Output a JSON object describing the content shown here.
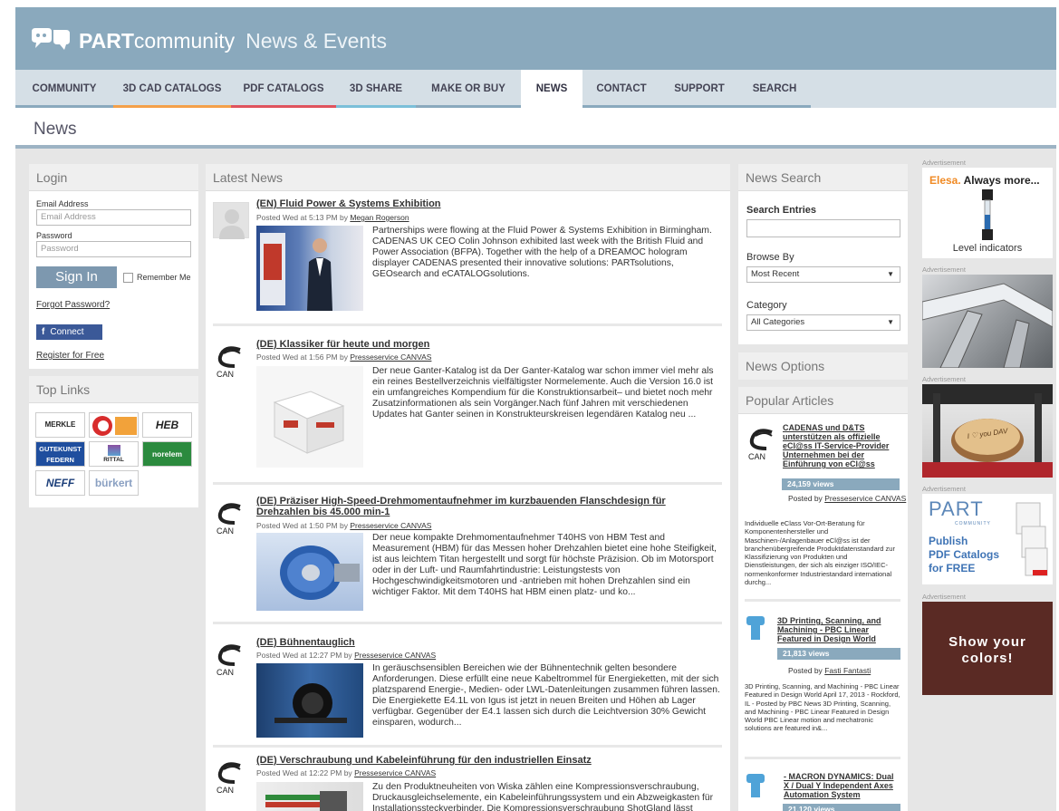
{
  "header": {
    "brand_bold": "PART",
    "brand_light": "community",
    "subtitle": "News & Events"
  },
  "nav": {
    "items": [
      {
        "label": "COMMUNITY",
        "color": "#8aa9bd"
      },
      {
        "label": "3D CAD CATALOGS",
        "color": "#f4a04a"
      },
      {
        "label": "PDF CATALOGS",
        "color": "#e0535d"
      },
      {
        "label": "3D SHARE",
        "color": "#7bbfd9"
      },
      {
        "label": "MAKE OR BUY",
        "color": "#8aa9bd"
      },
      {
        "label": "NEWS",
        "color": "#8aa9bd"
      },
      {
        "label": "CONTACT",
        "color": "#8aa9bd"
      },
      {
        "label": "SUPPORT",
        "color": "#8aa9bd"
      },
      {
        "label": "SEARCH",
        "color": "#8aa9bd"
      }
    ],
    "active": "NEWS"
  },
  "page": {
    "title": "News"
  },
  "login": {
    "heading": "Login",
    "email_label": "Email Address",
    "email_placeholder": "Email Address",
    "password_label": "Password",
    "password_placeholder": "Password",
    "signin": "Sign In",
    "remember": "Remember Me",
    "forgot": "Forgot Password?",
    "connect": "Connect",
    "register": "Register for Free"
  },
  "top_links": {
    "heading": "Top Links",
    "logos": [
      "MERKLE",
      "GANTER",
      "HEB",
      "GUTEKUNST FEDERN",
      "RITTAL",
      "norelem",
      "NEFF",
      "bürkert"
    ]
  },
  "news": {
    "heading": "Latest News",
    "articles": [
      {
        "title": "(EN) Fluid Power & Systems Exhibition",
        "meta": "Posted Wed at 5:13 PM by",
        "author": "Megan Rogerson",
        "text": "Partnerships were flowing at the Fluid Power & Systems Exhibition in Birmingham. CADENAS UK CEO Colin Johnson exhibited last week with the British Fluid and Power Association (BFPA). Together with the help of a DREAMOC hologram displayer CADENAS presented their innovative solutions: PARTsolutions, GEOsearch and eCATALOGsolutions."
      },
      {
        "title": "(DE) Klassiker für heute und morgen",
        "meta": "Posted Wed at 1:56 PM by",
        "author": "Presseservice CANVAS",
        "text": "Der neue Ganter-Katalog ist da Der Ganter-Katalog war schon immer viel mehr als ein reines Bestellverzeichnis vielfältigster Normelemente. Auch die Version 16.0 ist ein umfangreiches Kompendium für die Konstruktionsarbeit– und bietet noch mehr Zusatzinformationen als sein Vorgänger.Nach fünf Jahren mit verschiedenen Updates hat Ganter seinen in Konstrukteurskreisen legendären Katalog neu ..."
      },
      {
        "title": "(DE) Präziser High-Speed-Drehmomentaufnehmer im kurzbauenden Flanschdesign für Drehzahlen bis 45.000 min-1",
        "meta": "Posted Wed at 1:50 PM by",
        "author": "Presseservice CANVAS",
        "text": "Der neue kompakte Drehmomentaufnehmer T40HS von HBM Test and Measurement (HBM) für das Messen hoher Drehzahlen bietet eine hohe Steifigkeit, ist aus leichtem Titan hergestellt und sorgt für höchste Präzision.  Ob im Motorsport oder in der Luft- und Raumfahrtindustrie: Leistungstests von Hochgeschwindigkeitsmotoren und -antrieben mit hohen Drehzahlen sind ein wichtiger Faktor. Mit dem T40HS hat HBM einen platz- und ko..."
      },
      {
        "title": "(DE) Bühnentauglich",
        "meta": "Posted Wed at 12:27 PM by",
        "author": "Presseservice CANVAS",
        "text": "In geräuschsensiblen Bereichen wie der Bühnentechnik gelten besondere Anforderungen. Diese erfüllt eine neue Kabeltrommel für Energieketten, mit der sich platzsparend Energie-, Medien- oder LWL-Datenleitungen zusammen führen lassen. Die Energiekette E4.1L von Igus ist jetzt in neuen Breiten und Höhen ab Lager verfügbar. Gegenüber der E4.1 lassen sich durch die Leichtversion 30% Gewicht einsparen, wodurch..."
      },
      {
        "title": "(DE) Verschraubung und Kabeleinführung für den industriellen Einsatz",
        "meta": "Posted Wed at 12:22 PM by",
        "author": "Presseservice CANVAS",
        "text": "Zu den Produktneuheiten von Wiska zählen eine Kompressionsverschraubung, Druckausgleichselemente, ein Kabeleinführungssystem und ein Abzweigkasten für Installationssteckverbinder. Die Kompressionsverschraubung ShotGland lässt"
      }
    ]
  },
  "search": {
    "heading": "News Search",
    "entries_label": "Search Entries",
    "browse_label": "Browse By",
    "browse_value": "Most Recent",
    "category_label": "Category",
    "category_value": "All Categories"
  },
  "options": {
    "heading": "News Options"
  },
  "popular": {
    "heading": "Popular Articles",
    "items": [
      {
        "title": "CADENAS und D&TS unterstützen als offizielle eCl@ss IT-Service-Provider Unternehmen bei der Einführung von eCl@ss",
        "views": "24,159 views",
        "posted": "Posted by",
        "author": "Presseservice CANVAS",
        "desc": "Individuelle eClass Vor-Ort-Beratung für Komponentenhersteller und Maschinen-/Anlagenbauer eCl@ss ist der branchenübergreifende Produktdatenstandard zur Klassifizierung von Produkten und Dienstleistungen, der sich als einziger ISO/IEC-normenkonformer Industriestandard international durchg..."
      },
      {
        "title": "3D Printing, Scanning, and Machining - PBC Linear Featured in Design World",
        "views": "21,813 views",
        "posted": "Posted by",
        "author": "Fasti Fantasti",
        "desc": "3D Printing, Scanning, and Machining - PBC Linear Featured in Design World April 17, 2013 - Rockford, IL  - Posted by PBC News 3D Printing, Scanning, and Machining - PBC Linear Featured in Design World PBC Linear motion and mechatronic solutions are featured in&..."
      },
      {
        "title": "- MACRON DYNAMICS: Dual X / Dual Y Independent Axes Automation System",
        "views": "21,120 views"
      }
    ]
  },
  "ads": {
    "label": "Advertisement",
    "elesa_brand": "Elesa.",
    "elesa_tagline": "Always more...",
    "elesa_caption": "Level indicators",
    "part_logo": "PART",
    "part_sub": "COMMUNITY",
    "part_line1": "Publish",
    "part_line2": "PDF Catalogs",
    "part_line3": "for FREE",
    "show_line1": "Show your",
    "show_line2": "colors!",
    "cake_text": "I ♡ you DAV"
  }
}
